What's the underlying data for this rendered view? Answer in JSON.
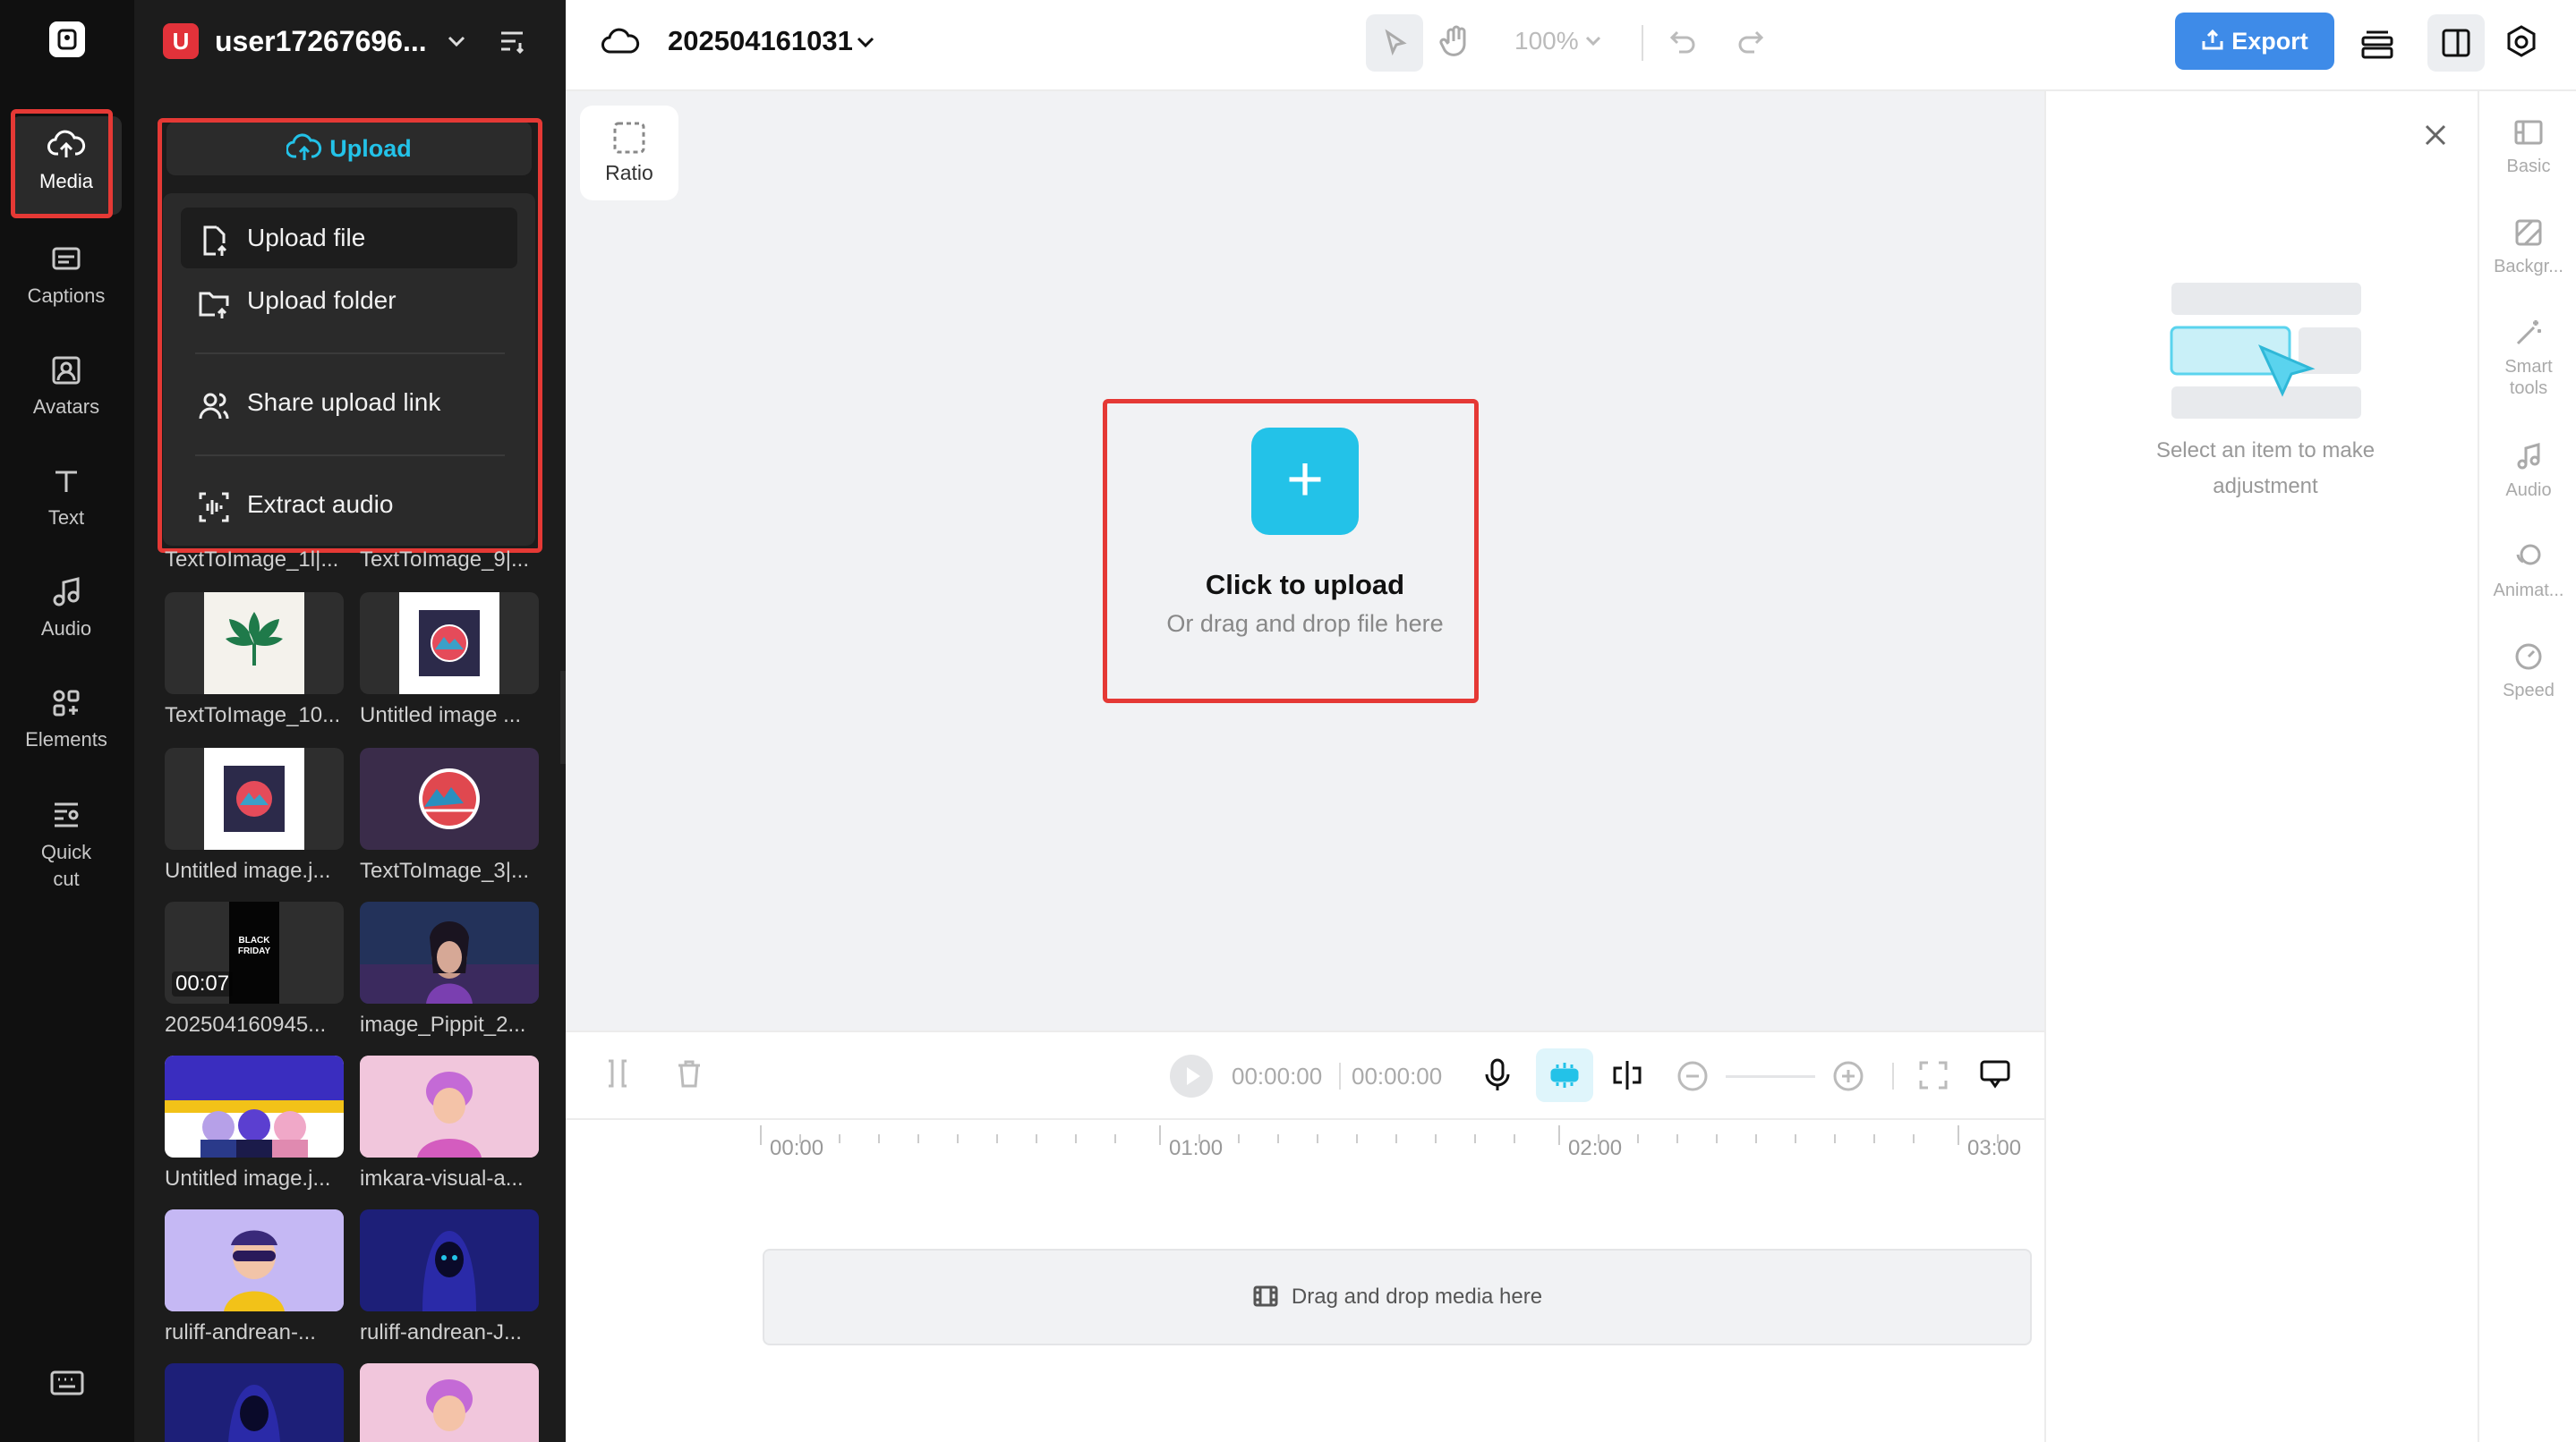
{
  "rail": {
    "items": [
      {
        "label": "Media",
        "icon": "cloud-upload-icon",
        "active": true
      },
      {
        "label": "Captions",
        "icon": "captions-icon"
      },
      {
        "label": "Avatars",
        "icon": "avatar-icon"
      },
      {
        "label": "Text",
        "icon": "text-icon"
      },
      {
        "label": "Audio",
        "icon": "music-note-icon"
      },
      {
        "label": "Elements",
        "icon": "elements-icon"
      },
      {
        "label": "Quick\ncut",
        "icon": "quick-cut-icon"
      }
    ]
  },
  "panel": {
    "avatar_letter": "U",
    "username": "user17267696...",
    "upload_label": "Upload",
    "menu": [
      {
        "label": "Upload file",
        "icon": "file-upload-icon"
      },
      {
        "label": "Upload folder",
        "icon": "folder-upload-icon"
      },
      {
        "label": "Share upload link",
        "icon": "share-users-icon"
      },
      {
        "label": "Extract audio",
        "icon": "audio-extract-icon"
      }
    ],
    "media": [
      {
        "name": "TextToImage_1l|..."
      },
      {
        "name": "TextToImage_9|..."
      },
      {
        "name": "TextToImage_10..."
      },
      {
        "name": "Untitled image ..."
      },
      {
        "name": "Untitled image.j..."
      },
      {
        "name": "TextToImage_3|..."
      },
      {
        "name": "202504160945...",
        "duration": "00:07"
      },
      {
        "name": "image_Pippit_2..."
      },
      {
        "name": "Untitled image.j..."
      },
      {
        "name": "imkara-visual-a..."
      },
      {
        "name": "ruliff-andrean-..."
      },
      {
        "name": "ruliff-andrean-J..."
      }
    ]
  },
  "topbar": {
    "project_name": "202504161031",
    "zoom": "100%",
    "export_label": "Export"
  },
  "canvas": {
    "ratio_label": "Ratio",
    "plus": "+",
    "click_title": "Click to upload",
    "click_sub": "Or drag and drop file here"
  },
  "props": {
    "message": "Select an item to make adjustment"
  },
  "sidetabs": [
    {
      "label": "Basic",
      "icon": "basic-icon"
    },
    {
      "label": "Backgr...",
      "icon": "background-icon"
    },
    {
      "label": "Smart tools",
      "icon": "magic-wand-icon"
    },
    {
      "label": "Audio",
      "icon": "music-note-icon"
    },
    {
      "label": "Animat...",
      "icon": "animation-icon"
    },
    {
      "label": "Speed",
      "icon": "speed-icon"
    }
  ],
  "timeline": {
    "current_time": "00:00:00",
    "total_time": "00:00:00",
    "ticks": [
      "00:00",
      "01:00",
      "02:00",
      "03:00"
    ],
    "drop_text": "Drag and drop media here"
  },
  "colors": {
    "accent": "#23c2e8",
    "export": "#3e8be8",
    "highlight": "#e53935"
  }
}
